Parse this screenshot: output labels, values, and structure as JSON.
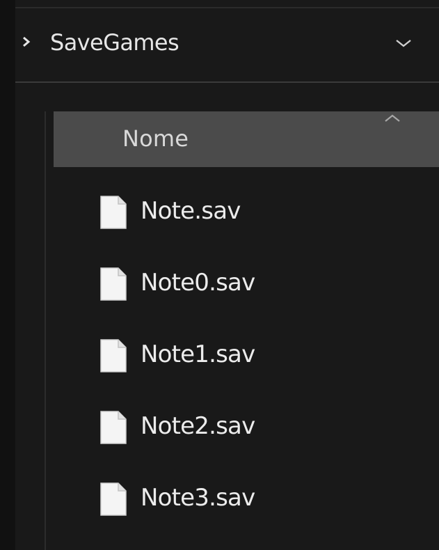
{
  "navigation": {
    "breadcrumb": {
      "expand_icon": "chevron-right",
      "label": "SaveGames",
      "dropdown_icon": "chevron-down"
    }
  },
  "file_list": {
    "column_header": {
      "label": "Nome",
      "sort_icon": "caret-up"
    },
    "files": [
      {
        "name": "Note.sav",
        "icon": "file-icon"
      },
      {
        "name": "Note0.sav",
        "icon": "file-icon"
      },
      {
        "name": "Note1.sav",
        "icon": "file-icon"
      },
      {
        "name": "Note2.sav",
        "icon": "file-icon"
      },
      {
        "name": "Note3.sav",
        "icon": "file-icon"
      }
    ]
  },
  "colors": {
    "background": "#191919",
    "header_background": "#4b4b4b",
    "text": "#ececec"
  }
}
